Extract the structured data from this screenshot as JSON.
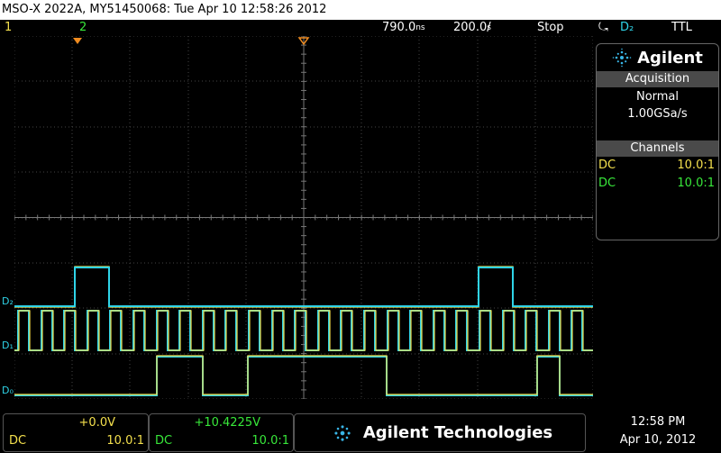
{
  "title": "MSO-X 2022A, MY51450068: Tue Apr 10 12:58:26 2012",
  "status": {
    "ch1": "1",
    "ch2": "2",
    "timebase": "790.0)",
    "timebase_display": "790.0ᵀ",
    "delay": "200.0%/",
    "run_state": "Stop",
    "trigger_src": "D₂",
    "trigger_level": "TTL"
  },
  "panel": {
    "brand": "Agilent",
    "acq_header": "Acquisition",
    "acq_mode": "Normal",
    "acq_rate": "1.00GSa/s",
    "ch_header": "Channels",
    "channels": [
      {
        "coupling": "DC",
        "probe": "10.0:1",
        "color": "#f4e04d"
      },
      {
        "coupling": "DC",
        "probe": "10.0:1",
        "color": "#38e83a"
      }
    ]
  },
  "bottom": {
    "ch1": {
      "offset": "+0.0V",
      "coupling": "DC",
      "probe": "10.0:1"
    },
    "ch2": {
      "offset": "+10.4225V",
      "coupling": "DC",
      "probe": "10.0:1"
    },
    "brand": "Agilent Technologies",
    "time": "12:58 PM",
    "date": "Apr 10, 2012"
  },
  "digital_labels": [
    "D₂",
    "D₁",
    "D₀"
  ],
  "colors": {
    "ch1": "#f4e04d",
    "ch2": "#38e83a",
    "digital": "#2fd4e8",
    "grid": "#555555"
  }
}
